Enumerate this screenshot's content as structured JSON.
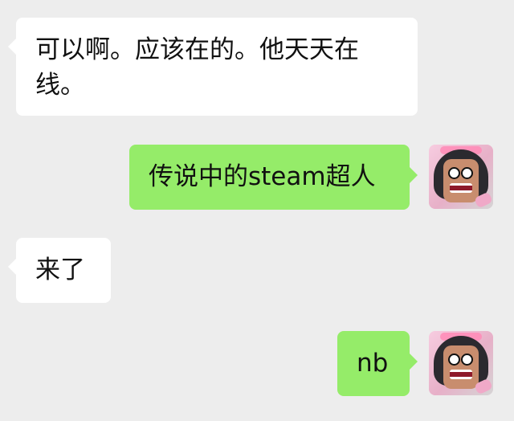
{
  "messages": [
    {
      "id": "m1",
      "direction": "incoming",
      "text": "可以啊。应该在的。他天天在线。"
    },
    {
      "id": "m2",
      "direction": "outgoing",
      "text": "传说中的steam超人"
    },
    {
      "id": "m3",
      "direction": "incoming",
      "text": "来了"
    },
    {
      "id": "m4",
      "direction": "outgoing",
      "text": "nb"
    }
  ],
  "colors": {
    "background": "#ededed",
    "incoming_bubble": "#ffffff",
    "outgoing_bubble": "#95ec69",
    "text": "#111111"
  },
  "avatars": [
    {
      "icon": "user-avatar-icon"
    },
    {
      "icon": "user-avatar-icon"
    }
  ]
}
